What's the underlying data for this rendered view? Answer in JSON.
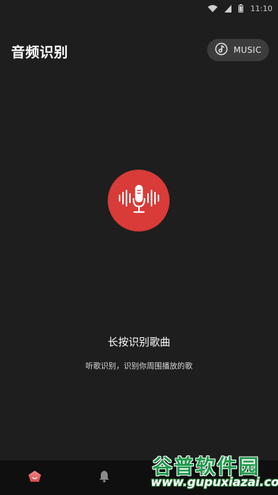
{
  "status_bar": {
    "time": "11:10"
  },
  "header": {
    "title": "音频识别",
    "music_label": "MUSIC"
  },
  "main": {
    "prompt_title": "长按识别歌曲",
    "prompt_subtitle": "听歌识别，识别你周围播放的歌"
  },
  "colors": {
    "accent": "#d93b38",
    "background": "#1e1e1e",
    "nav_background": "#0f0f0f"
  },
  "bottom_nav": {
    "items": [
      {
        "icon": "recognize-icon",
        "active": true
      },
      {
        "icon": "bell-icon",
        "active": false
      }
    ]
  },
  "watermark": {
    "text": "谷普软件园",
    "url": "www.gupuxiazai.com"
  }
}
